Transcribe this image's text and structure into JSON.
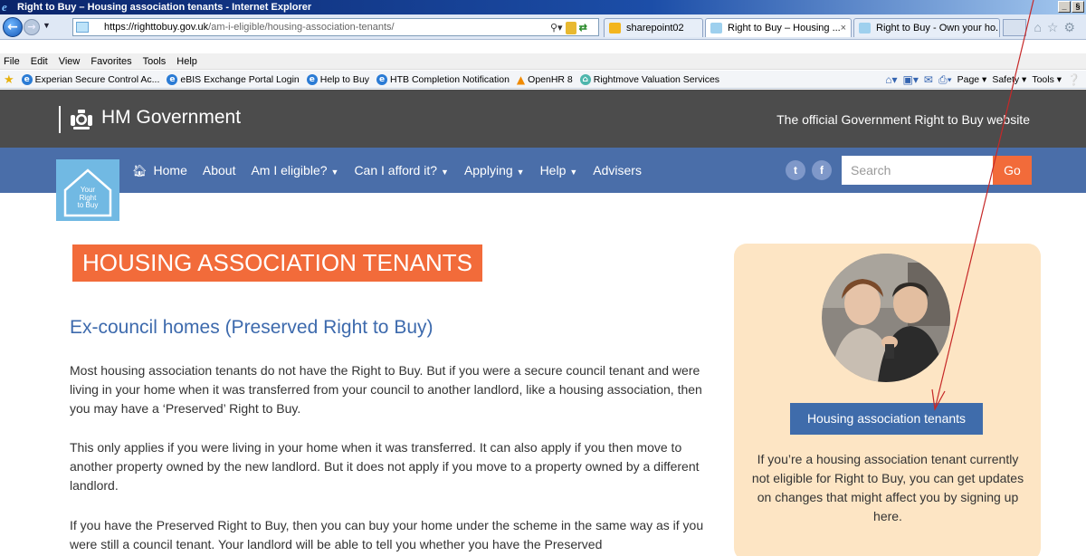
{
  "browser": {
    "window_title": "Right to Buy – Housing association tenants - Internet Explorer",
    "window_buttons": [
      "_",
      "§"
    ],
    "address": {
      "url_bold": "https://righttobuy.gov.uk",
      "url_path": "/am-i-eligible/housing-association-tenants/"
    },
    "tabs": [
      {
        "label": "sharepoint02"
      },
      {
        "label": "Right to Buy – Housing ...",
        "close": "×"
      },
      {
        "label": "Right to Buy - Own your ho..."
      }
    ],
    "menu": [
      "File",
      "Edit",
      "View",
      "Favorites",
      "Tools",
      "Help"
    ],
    "favorites": [
      {
        "label": "Experian Secure Control Ac..."
      },
      {
        "label": "eBIS Exchange Portal Login"
      },
      {
        "label": "Help to Buy"
      },
      {
        "label": "HTB Completion Notification"
      },
      {
        "label": "OpenHR 8"
      },
      {
        "label": "Rightmove Valuation Services"
      }
    ],
    "command_bar": {
      "page": "Page",
      "safety": "Safety",
      "tools": "Tools"
    }
  },
  "site": {
    "gov_name": "HM Government",
    "tagline": "The official Government Right to Buy website",
    "logo_text": [
      "Your",
      "Right",
      "to Buy"
    ],
    "nav": {
      "home": "Home",
      "about": "About",
      "eligible": "Am I eligible?",
      "afford": "Can I afford it?",
      "applying": "Applying",
      "help": "Help",
      "advisers": "Advisers"
    },
    "social": {
      "twitter": "t",
      "facebook": "f"
    },
    "search": {
      "placeholder": "Search",
      "button": "Go"
    }
  },
  "content": {
    "title": "HOUSING ASSOCIATION TENANTS",
    "subheading": "Ex-council homes (Preserved Right to Buy)",
    "paragraphs": [
      "Most housing association tenants do not have the Right to Buy. But if you were a secure council tenant and were living in your home when it was transferred from your council to another landlord, like a housing association, then you may have a ‘Preserved’ Right to Buy.",
      "This only applies if you were living in your home when it was transferred. It can also apply if you then move to another property owned by the new landlord. But it does not apply if you move to a property owned by a different landlord.",
      "If you have the Preserved Right to Buy, then you can buy your home under the scheme in the same way as if you were still a council tenant. Your landlord will be able to tell you whether you have the Preserved"
    ]
  },
  "sidebar": {
    "button": "Housing association tenants",
    "text": "If you’re a housing association tenant currently not eligible for Right to Buy, you can get updates on changes that might affect you by signing up here."
  },
  "colors": {
    "accent": "#f26b3a",
    "nav": "#4a6ea9",
    "govbar": "#4c4c4c",
    "sidebar_bg": "#fde5c4",
    "annotation": "#c62828"
  }
}
